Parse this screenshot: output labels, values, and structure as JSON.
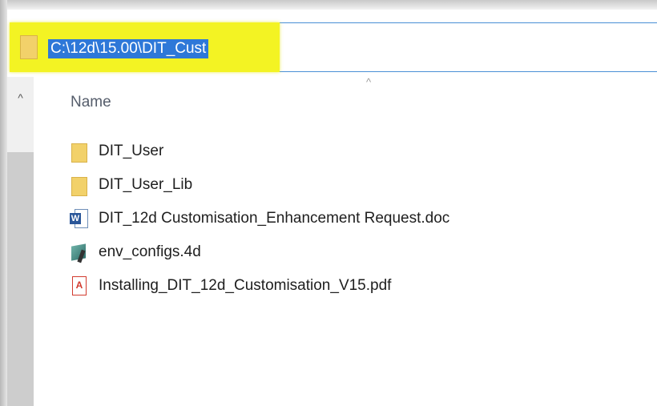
{
  "address_bar": {
    "path": "C:\\12d\\15.00\\DIT_Cust",
    "highlight_color": "#f3f323",
    "selection_color": "#2e78d8"
  },
  "columns": {
    "name_label": "Name"
  },
  "files": [
    {
      "name": "DIT_User",
      "icon": "folder-icon"
    },
    {
      "name": "DIT_User_Lib",
      "icon": "folder-icon"
    },
    {
      "name": "DIT_12d Customisation_Enhancement Request.doc",
      "icon": "word-document-icon"
    },
    {
      "name": "env_configs.4d",
      "icon": "4d-file-icon"
    },
    {
      "name": "Installing_DIT_12d_Customisation_V15.pdf",
      "icon": "pdf-icon"
    }
  ],
  "glyphs": {
    "scroll_up": "^",
    "sort_caret": "^"
  }
}
